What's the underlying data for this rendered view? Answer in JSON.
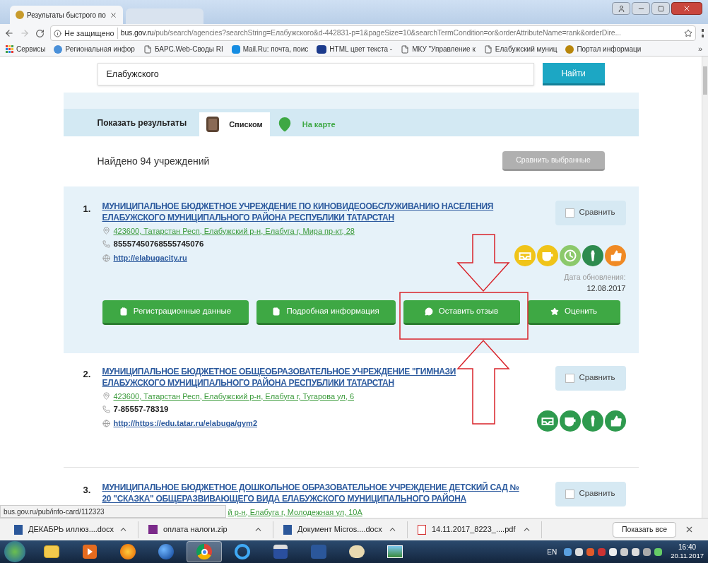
{
  "browser": {
    "tabs": [
      {
        "title": "Результаты быстрого по",
        "selected": true
      },
      {
        "selected": false
      }
    ],
    "address": {
      "security": "Не защищено",
      "host": "bus.gov.ru",
      "path": "/pub/search/agencies?searchString=Елабужского&d-442831-p=1&pageSize=10&searchTermCondition=or&orderAttributeName=rank&orderDire..."
    },
    "bookmarks": [
      {
        "kind": "apps",
        "label": "Сервисы"
      },
      {
        "kind": "site",
        "label": "Региональная инфор"
      },
      {
        "kind": "page",
        "label": "БАРС.Web-Своды RI"
      },
      {
        "kind": "mail",
        "label": "Mail.Ru: почта, поис"
      },
      {
        "kind": "html",
        "label": "HTML цвет текста - "
      },
      {
        "kind": "page",
        "label": "МКУ \"Управление к"
      },
      {
        "kind": "page",
        "label": "Елабужский муниц"
      },
      {
        "kind": "portal",
        "label": "Портал информаци"
      }
    ],
    "bookmarks_more": "»"
  },
  "search": {
    "value": "Елабужского",
    "button": "Найти"
  },
  "view": {
    "label": "Показать результаты",
    "tabs": [
      {
        "kind": "list",
        "label": "Списком",
        "selected": true
      },
      {
        "kind": "map",
        "label": "На карте",
        "selected": false
      }
    ]
  },
  "found": "Найдено 94 учреждений",
  "compare_selected": {
    "label": "Сравнить выбранные",
    "disabled": true
  },
  "results": [
    {
      "number": "1.",
      "highlighted": true,
      "title_lines": [
        "МУНИЦИПАЛЬНОЕ БЮДЖЕТНОЕ УЧРЕЖДЕНИЕ ПО КИНОВИДЕООБСЛУЖИВАНИЮ НАСЕЛЕНИЯ",
        "ЕЛАБУЖСКОГО МУНИЦИПАЛЬНОГО РАЙОНА РЕСПУБЛИКИ ТАТАРСТАН"
      ],
      "address": "423600, Татарстан Респ, Елабужский р-н, Елабуга г, Мира пр-кт, 28",
      "phone": "85557450768555745076",
      "website": "http://elabugacity.ru",
      "compare": {
        "label": "Сравнить",
        "checked": false
      },
      "badges": [
        {
          "kind": "inbox",
          "color": "#f0c419"
        },
        {
          "kind": "cup",
          "color": "#f0c419"
        },
        {
          "kind": "clock",
          "color": "#8cc96b"
        },
        {
          "kind": "tie",
          "color": "#2e8b4e"
        },
        {
          "kind": "thumb",
          "color": "#f08a24"
        }
      ],
      "updated_label": "Дата обновления:",
      "updated": "12.08.2017",
      "actions": [
        {
          "kind": "clipboard",
          "label": "Регистрационные данные"
        },
        {
          "kind": "document",
          "label": "Подробная информация"
        },
        {
          "kind": "comment",
          "label": "Оставить отзыв"
        },
        {
          "kind": "star",
          "label": "Оценить"
        }
      ]
    },
    {
      "number": "2.",
      "highlighted": false,
      "title_lines": [
        "МУНИЦИПАЛЬНОЕ БЮДЖЕТНОЕ ОБЩЕОБРАЗОВАТЕЛЬНОЕ УЧРЕЖДЕНИЕ \"ГИМНАЗИ",
        "ЕЛАБУЖСКОГО МУНИЦИПАЛЬНОГО РАЙОНА РЕСПУБЛИКИ ТАТАРСТАН"
      ],
      "address": "423600, Татарстан Респ, Елабужский р-н, Елабуга г, Тугарова ул, 6",
      "phone": "7-85557-78319",
      "website": "http://https://edu.tatar.ru/elabuga/gym2",
      "compare": {
        "label": "Сравнить",
        "checked": false
      },
      "badges": [
        {
          "kind": "inbox",
          "color": "#2e9a4e"
        },
        {
          "kind": "cup",
          "color": "#2e9a4e"
        },
        {
          "kind": "tie",
          "color": "#2e9a4e"
        },
        {
          "kind": "thumb",
          "color": "#2e9a4e"
        }
      ]
    },
    {
      "number": "3.",
      "highlighted": false,
      "title_lines": [
        "МУНИЦИПАЛЬНОЕ БЮДЖЕТНОЕ ДОШКОЛЬНОЕ ОБРАЗОВАТЕЛЬНОЕ УЧРЕЖДЕНИЕ ДЕТСКИЙ САД №",
        "20 \"СКАЗКА\" ОБЩЕРАЗВИВАЮЩЕГО ВИДА ЕЛАБУЖСКОГО МУНИЦИПАЛЬНОГО РАЙОНА"
      ],
      "address": "й р-н, Елабуга г, Молодежная ул, 10А",
      "address_cut": true,
      "compare": {
        "label": "Сравнить",
        "checked": false
      }
    }
  ],
  "status_url": "bus.gov.ru/pub/info-card/112323",
  "downloads": {
    "items": [
      {
        "kind": "doc",
        "name": "ДЕКАБРЬ иллюз....docx"
      },
      {
        "kind": "zip",
        "name": "оплата налоги.zip"
      },
      {
        "kind": "doc",
        "name": "Документ Micros....docx"
      },
      {
        "kind": "pdf",
        "name": "14.11.2017_8223_....pdf"
      }
    ],
    "show_all": "Показать все"
  },
  "taskbar": {
    "apps": [
      {
        "kind": "folder",
        "selected": false
      },
      {
        "kind": "media",
        "selected": false
      },
      {
        "kind": "firefox",
        "selected": false
      },
      {
        "kind": "globe",
        "selected": false
      },
      {
        "kind": "chrome",
        "selected": true
      },
      {
        "kind": "ie",
        "selected": false
      },
      {
        "kind": "save",
        "selected": false
      },
      {
        "kind": "word",
        "selected": false
      },
      {
        "kind": "paint",
        "selected": false
      },
      {
        "kind": "picture",
        "selected": false
      }
    ],
    "lang": "EN",
    "time": "16:40",
    "date": "20.11.2017"
  }
}
